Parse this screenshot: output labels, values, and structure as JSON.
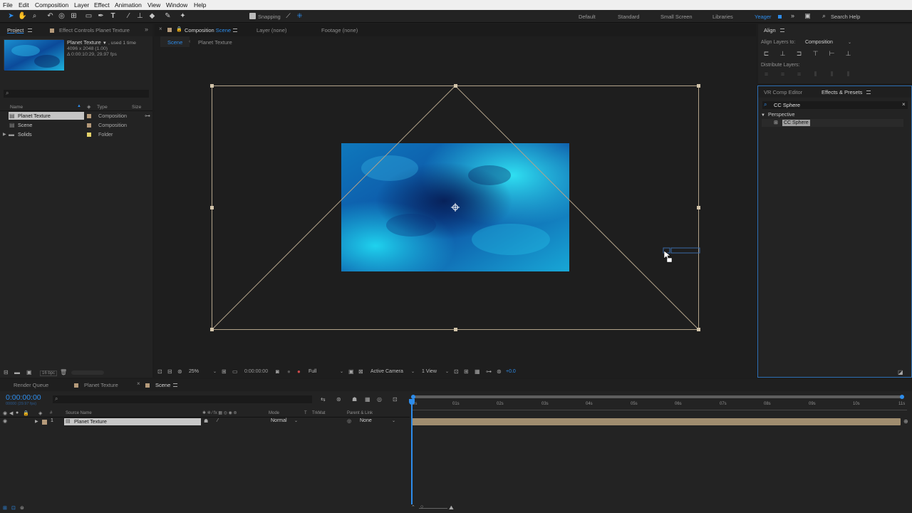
{
  "menu": [
    "File",
    "Edit",
    "Composition",
    "Layer",
    "Effect",
    "Animation",
    "View",
    "Window",
    "Help"
  ],
  "toolbar": {
    "snapping_label": "Snapping",
    "workspaces": [
      "Default",
      "Standard",
      "Small Screen",
      "Libraries",
      "Yeager"
    ],
    "active_workspace": "Yeager",
    "search_help_placeholder": "Search Help"
  },
  "project_panel": {
    "tabs": [
      "Project",
      "Effect Controls Planet Texture"
    ],
    "selected_item_name": "Planet Texture",
    "selected_item_usage": ", used 1 time",
    "selected_item_dims": "4096 x 2048 (1.00)",
    "selected_item_duration": "Δ 0:00:10:29, 29.97 fps",
    "columns": [
      "Name",
      "Type",
      "Size"
    ],
    "items": [
      {
        "name": "Planet Texture",
        "type": "Composition",
        "color": "#b59a7a",
        "selected": true,
        "icon": "composition-icon"
      },
      {
        "name": "Scene",
        "type": "Composition",
        "color": "#b59a7a",
        "selected": false,
        "icon": "composition-icon"
      },
      {
        "name": "Solids",
        "type": "Folder",
        "color": "#e6d36a",
        "selected": false,
        "icon": "folder-icon"
      }
    ],
    "bpc": "16 bpc"
  },
  "comp_panel": {
    "tabs": [
      "Composition Scene",
      "Layer (none)",
      "Footage (none)"
    ],
    "tab_prefix": "Composition",
    "tab_name": "Scene",
    "breadcrumbs": [
      "Scene",
      "Planet Texture"
    ],
    "zoom": "25%",
    "timecode": "0:00:00:00",
    "resolution": "Full",
    "camera": "Active Camera",
    "views": "1 View",
    "exposure": "+0.0"
  },
  "align_panel": {
    "title": "Align",
    "align_to_label": "Align Layers to:",
    "align_to_value": "Composition",
    "distribute_label": "Distribute Layers:"
  },
  "effects_panel": {
    "tabs": [
      "VR Comp Editor",
      "Effects & Presets"
    ],
    "search_value": "CC Sphere",
    "category": "Perspective",
    "effect": "CC Sphere"
  },
  "timeline": {
    "tabs": [
      "Render Queue",
      "Planet Texture",
      "Scene"
    ],
    "timecode": "0:00:00:00",
    "fps_sub": "00000 (29.97 fps)",
    "columns": {
      "source": "Source Name",
      "mode": "Mode",
      "t": "T",
      "trkmat": "TrkMat",
      "parent": "Parent & Link"
    },
    "ruler": [
      "0s",
      "01s",
      "02s",
      "03s",
      "04s",
      "05s",
      "06s",
      "07s",
      "08s",
      "09s",
      "10s",
      "11s"
    ],
    "layers": [
      {
        "index": "1",
        "name": "Planet Texture",
        "mode": "Normal",
        "parent": "None"
      }
    ]
  },
  "colors": {
    "accent": "#2d8ceb",
    "bound_box": "#b3a38a",
    "layer_bar": "#a08d6f",
    "texture_dark": "#0a2e6a",
    "texture_light": "#1ec5e6"
  }
}
